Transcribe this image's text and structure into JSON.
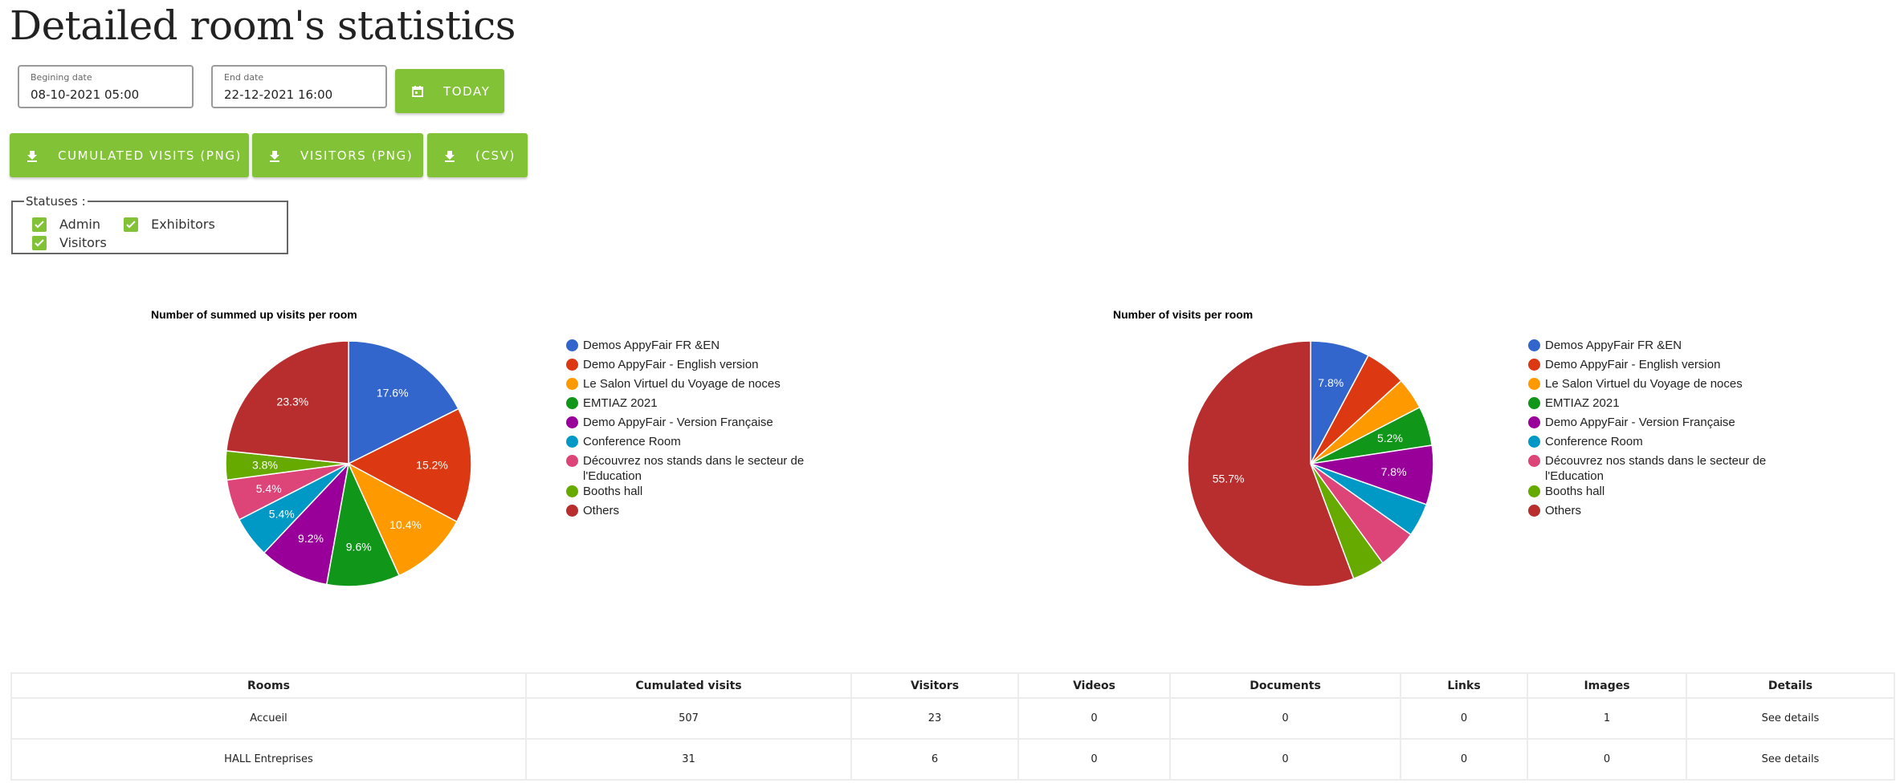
{
  "page": {
    "title": "Detailed room's statistics"
  },
  "filters": {
    "begin_date": {
      "label": "Begining date",
      "value": "08-10-2021 05:00"
    },
    "end_date": {
      "label": "End date",
      "value": "22-12-2021 16:00"
    },
    "today_button": {
      "label": "TODAY",
      "icon": "calendar-icon"
    }
  },
  "exports": [
    {
      "label": "CUMULATED VISITS (PNG)",
      "icon": "download-icon"
    },
    {
      "label": "VISITORS (PNG)",
      "icon": "download-icon"
    },
    {
      "label": "(CSV)",
      "icon": "download-icon"
    }
  ],
  "statuses": {
    "legend": "Statuses :",
    "options": [
      {
        "label": "Admin",
        "checked": true
      },
      {
        "label": "Exhibitors",
        "checked": true
      },
      {
        "label": "Visitors",
        "checked": true
      }
    ]
  },
  "colors": {
    "accent": "#82c236",
    "slices": [
      "#3366cc",
      "#dc3912",
      "#ff9900",
      "#109618",
      "#990099",
      "#0099c6",
      "#dd4477",
      "#66aa00",
      "#b82e2e"
    ]
  },
  "chart_data": [
    {
      "type": "pie",
      "title": "Number of summed up visits per room",
      "categories": [
        "Demos AppyFair FR &EN",
        "Demo AppyFair - English version",
        "Le Salon Virtuel du Voyage de noces",
        "EMTIAZ 2021",
        "Demo AppyFair - Version Française",
        "Conference Room",
        "Découvrez nos stands dans le secteur de l'Education",
        "Booths hall",
        "Others"
      ],
      "values": [
        17.6,
        15.2,
        10.4,
        9.6,
        9.2,
        5.4,
        5.4,
        3.8,
        23.3
      ],
      "labels": [
        "17.6%",
        "15.2%",
        "10.4%",
        "9.6%",
        "9.2%",
        "5.4%",
        "5.4%",
        "3.8%",
        "23.3%"
      ],
      "legend_position": "right"
    },
    {
      "type": "pie",
      "title": "Number of visits per room",
      "categories": [
        "Demos AppyFair FR &EN",
        "Demo AppyFair - English version",
        "Le Salon Virtuel du Voyage de noces",
        "EMTIAZ 2021",
        "Demo AppyFair - Version Française",
        "Conference Room",
        "Découvrez nos stands dans le secteur de l'Education",
        "Booths hall",
        "Others"
      ],
      "values": [
        7.8,
        5.4,
        4.2,
        5.2,
        7.8,
        4.4,
        5.2,
        4.3,
        55.7
      ],
      "labels": [
        "7.8%",
        "",
        "",
        "5.2%",
        "7.8%",
        "",
        "",
        "",
        "55.7%"
      ],
      "legend_position": "right"
    }
  ],
  "table": {
    "columns": [
      "Rooms",
      "Cumulated visits",
      "Visitors",
      "Videos",
      "Documents",
      "Links",
      "Images",
      "Details"
    ],
    "rows": [
      [
        "Accueil",
        "507",
        "23",
        "0",
        "0",
        "0",
        "1",
        "See details"
      ],
      [
        "HALL Entreprises",
        "31",
        "6",
        "0",
        "0",
        "0",
        "0",
        "See details"
      ]
    ]
  }
}
